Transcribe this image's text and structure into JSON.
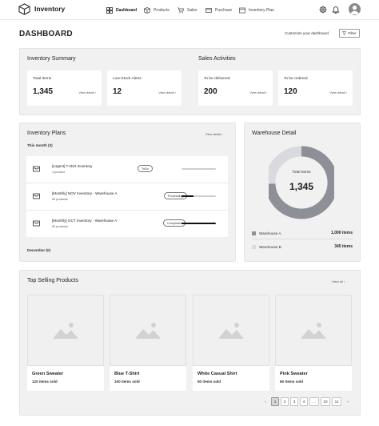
{
  "app": {
    "title": "Inventory"
  },
  "nav": [
    {
      "label": "Dashboard",
      "icon": "grid-icon",
      "active": true
    },
    {
      "label": "Products",
      "icon": "box-icon",
      "active": false
    },
    {
      "label": "Sales",
      "icon": "cart-icon",
      "active": false
    },
    {
      "label": "Purchase",
      "icon": "purchase-icon",
      "active": false
    },
    {
      "label": "Inventory Plan",
      "icon": "plan-icon",
      "active": false
    }
  ],
  "header": {
    "title": "DASHBOARD",
    "customize": "Customize your dashboard",
    "filter": "Filter"
  },
  "inventory_summary": {
    "title": "Inventory Summary",
    "cards": [
      {
        "label": "Total Items",
        "value": "1,345",
        "link": "View detail"
      },
      {
        "label": "Low-Stock Alerts",
        "value": "12",
        "link": "View detail"
      }
    ]
  },
  "sales_activities": {
    "title": "Sales Activities",
    "cards": [
      {
        "label": "To be delivered",
        "value": "200",
        "link": "View detail"
      },
      {
        "label": "To be ordered",
        "value": "120",
        "link": "View detail"
      }
    ]
  },
  "inventory_plans": {
    "title": "Inventory Plans",
    "view_link": "View detail",
    "group_current": "This month (3)",
    "group_next": "December (0)",
    "plans": [
      {
        "name": "[Urgent] T-shirt Inventory",
        "sub": "1 product",
        "status": "ToDo",
        "progress": 1.0,
        "bar_color": "#cfcfcf"
      },
      {
        "name": "[Monthly] NOV Inventory - Warehouse A",
        "sub": "50 products",
        "status": "Processing",
        "progress": 0.35,
        "bar_color": "#111111"
      },
      {
        "name": "[Monthly] OCT Inventory - Warehouse A",
        "sub": "50 products",
        "status": "Completed",
        "progress": 1.0,
        "bar_color": "#111111"
      }
    ]
  },
  "warehouse": {
    "title": "Warehouse Detail",
    "total_label": "Total Items",
    "total_value": "1,345",
    "items": [
      {
        "name": "Warehouse A",
        "value": "1,000 items",
        "color": "#8e9097"
      },
      {
        "name": "Warehouse B",
        "value": "345 items",
        "color": "#d9dadd"
      }
    ]
  },
  "top_selling": {
    "title": "Top Selling Products",
    "view_link": "View all",
    "products": [
      {
        "name": "Green Sweater",
        "sold": "120 items sold"
      },
      {
        "name": "Blue T-Shirt",
        "sold": "100 items sold"
      },
      {
        "name": "White Casual Shirt",
        "sold": "90 items sold"
      },
      {
        "name": "Pink Sweater",
        "sold": "80 items sold"
      }
    ]
  },
  "pagination": {
    "prev": "‹",
    "pages": [
      "1",
      "2",
      "3",
      "4",
      "...",
      "10",
      "11"
    ],
    "next": "›",
    "current": "1"
  }
}
